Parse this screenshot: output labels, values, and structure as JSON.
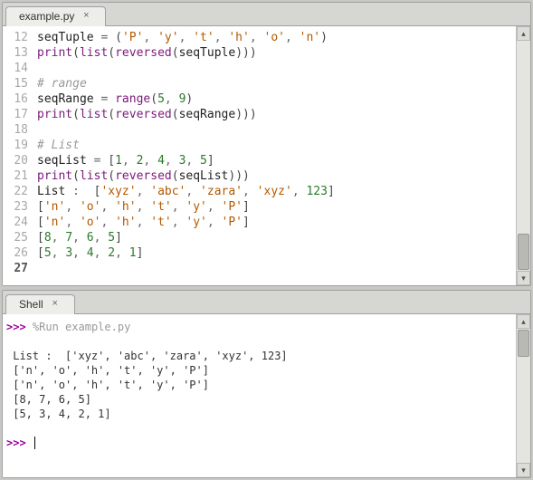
{
  "editor": {
    "tab_label": "example.py",
    "close_glyph": "×",
    "lines": [
      {
        "n": 12,
        "tokens": [
          [
            "id",
            "seqTuple "
          ],
          [
            "op",
            "= "
          ],
          [
            "br",
            "("
          ],
          [
            "str",
            "'P'"
          ],
          [
            "op",
            ", "
          ],
          [
            "str",
            "'y'"
          ],
          [
            "op",
            ", "
          ],
          [
            "str",
            "'t'"
          ],
          [
            "op",
            ", "
          ],
          [
            "str",
            "'h'"
          ],
          [
            "op",
            ", "
          ],
          [
            "str",
            "'o'"
          ],
          [
            "op",
            ", "
          ],
          [
            "str",
            "'n'"
          ],
          [
            "br",
            ")"
          ]
        ]
      },
      {
        "n": 13,
        "tokens": [
          [
            "fn",
            "print"
          ],
          [
            "br",
            "("
          ],
          [
            "fn",
            "list"
          ],
          [
            "br",
            "("
          ],
          [
            "fn",
            "reversed"
          ],
          [
            "br",
            "("
          ],
          [
            "id",
            "seqTuple"
          ],
          [
            "br",
            ")"
          ],
          [
            "br",
            ")"
          ],
          [
            "br",
            ")"
          ]
        ]
      },
      {
        "n": 14,
        "tokens": []
      },
      {
        "n": 15,
        "tokens": [
          [
            "cmt",
            "# range"
          ]
        ]
      },
      {
        "n": 16,
        "tokens": [
          [
            "id",
            "seqRange "
          ],
          [
            "op",
            "= "
          ],
          [
            "fn",
            "range"
          ],
          [
            "br",
            "("
          ],
          [
            "num",
            "5"
          ],
          [
            "op",
            ", "
          ],
          [
            "num",
            "9"
          ],
          [
            "br",
            ")"
          ]
        ]
      },
      {
        "n": 17,
        "tokens": [
          [
            "fn",
            "print"
          ],
          [
            "br",
            "("
          ],
          [
            "fn",
            "list"
          ],
          [
            "br",
            "("
          ],
          [
            "fn",
            "reversed"
          ],
          [
            "br",
            "("
          ],
          [
            "id",
            "seqRange"
          ],
          [
            "br",
            ")"
          ],
          [
            "br",
            ")"
          ],
          [
            "br",
            ")"
          ]
        ]
      },
      {
        "n": 18,
        "tokens": []
      },
      {
        "n": 19,
        "tokens": [
          [
            "cmt",
            "# List"
          ]
        ]
      },
      {
        "n": 20,
        "tokens": [
          [
            "id",
            "seqList "
          ],
          [
            "op",
            "= "
          ],
          [
            "br",
            "["
          ],
          [
            "num",
            "1"
          ],
          [
            "op",
            ", "
          ],
          [
            "num",
            "2"
          ],
          [
            "op",
            ", "
          ],
          [
            "num",
            "4"
          ],
          [
            "op",
            ", "
          ],
          [
            "num",
            "3"
          ],
          [
            "op",
            ", "
          ],
          [
            "num",
            "5"
          ],
          [
            "br",
            "]"
          ]
        ]
      },
      {
        "n": 21,
        "tokens": [
          [
            "fn",
            "print"
          ],
          [
            "br",
            "("
          ],
          [
            "fn",
            "list"
          ],
          [
            "br",
            "("
          ],
          [
            "fn",
            "reversed"
          ],
          [
            "br",
            "("
          ],
          [
            "id",
            "seqList"
          ],
          [
            "br",
            ")"
          ],
          [
            "br",
            ")"
          ],
          [
            "br",
            ")"
          ]
        ]
      },
      {
        "n": 22,
        "tokens": [
          [
            "id",
            "List "
          ],
          [
            "op",
            ":  "
          ],
          [
            "br",
            "["
          ],
          [
            "str",
            "'xyz'"
          ],
          [
            "op",
            ", "
          ],
          [
            "str",
            "'abc'"
          ],
          [
            "op",
            ", "
          ],
          [
            "str",
            "'zara'"
          ],
          [
            "op",
            ", "
          ],
          [
            "str",
            "'xyz'"
          ],
          [
            "op",
            ", "
          ],
          [
            "num",
            "123"
          ],
          [
            "br",
            "]"
          ]
        ]
      },
      {
        "n": 23,
        "tokens": [
          [
            "br",
            "["
          ],
          [
            "str",
            "'n'"
          ],
          [
            "op",
            ", "
          ],
          [
            "str",
            "'o'"
          ],
          [
            "op",
            ", "
          ],
          [
            "str",
            "'h'"
          ],
          [
            "op",
            ", "
          ],
          [
            "str",
            "'t'"
          ],
          [
            "op",
            ", "
          ],
          [
            "str",
            "'y'"
          ],
          [
            "op",
            ", "
          ],
          [
            "str",
            "'P'"
          ],
          [
            "br",
            "]"
          ]
        ]
      },
      {
        "n": 24,
        "tokens": [
          [
            "br",
            "["
          ],
          [
            "str",
            "'n'"
          ],
          [
            "op",
            ", "
          ],
          [
            "str",
            "'o'"
          ],
          [
            "op",
            ", "
          ],
          [
            "str",
            "'h'"
          ],
          [
            "op",
            ", "
          ],
          [
            "str",
            "'t'"
          ],
          [
            "op",
            ", "
          ],
          [
            "str",
            "'y'"
          ],
          [
            "op",
            ", "
          ],
          [
            "str",
            "'P'"
          ],
          [
            "br",
            "]"
          ]
        ]
      },
      {
        "n": 25,
        "tokens": [
          [
            "br",
            "["
          ],
          [
            "num",
            "8"
          ],
          [
            "op",
            ", "
          ],
          [
            "num",
            "7"
          ],
          [
            "op",
            ", "
          ],
          [
            "num",
            "6"
          ],
          [
            "op",
            ", "
          ],
          [
            "num",
            "5"
          ],
          [
            "br",
            "]"
          ]
        ]
      },
      {
        "n": 26,
        "tokens": [
          [
            "br",
            "["
          ],
          [
            "num",
            "5"
          ],
          [
            "op",
            ", "
          ],
          [
            "num",
            "3"
          ],
          [
            "op",
            ", "
          ],
          [
            "num",
            "4"
          ],
          [
            "op",
            ", "
          ],
          [
            "num",
            "2"
          ],
          [
            "op",
            ", "
          ],
          [
            "num",
            "1"
          ],
          [
            "br",
            "]"
          ]
        ]
      },
      {
        "n": 27,
        "tokens": [],
        "current": true
      }
    ],
    "scroll_up_glyph": "▴",
    "scroll_down_glyph": "▾"
  },
  "shell": {
    "tab_label": "Shell",
    "close_glyph": "×",
    "prompt": ">>>",
    "run_cmd": "%Run example.py",
    "output_lines": [
      " List :  ['xyz', 'abc', 'zara', 'xyz', 123]",
      " ['n', 'o', 'h', 't', 'y', 'P']",
      " ['n', 'o', 'h', 't', 'y', 'P']",
      " [8, 7, 6, 5]",
      " [5, 3, 4, 2, 1]"
    ],
    "scroll_up_glyph": "▴",
    "scroll_down_glyph": "▾"
  }
}
